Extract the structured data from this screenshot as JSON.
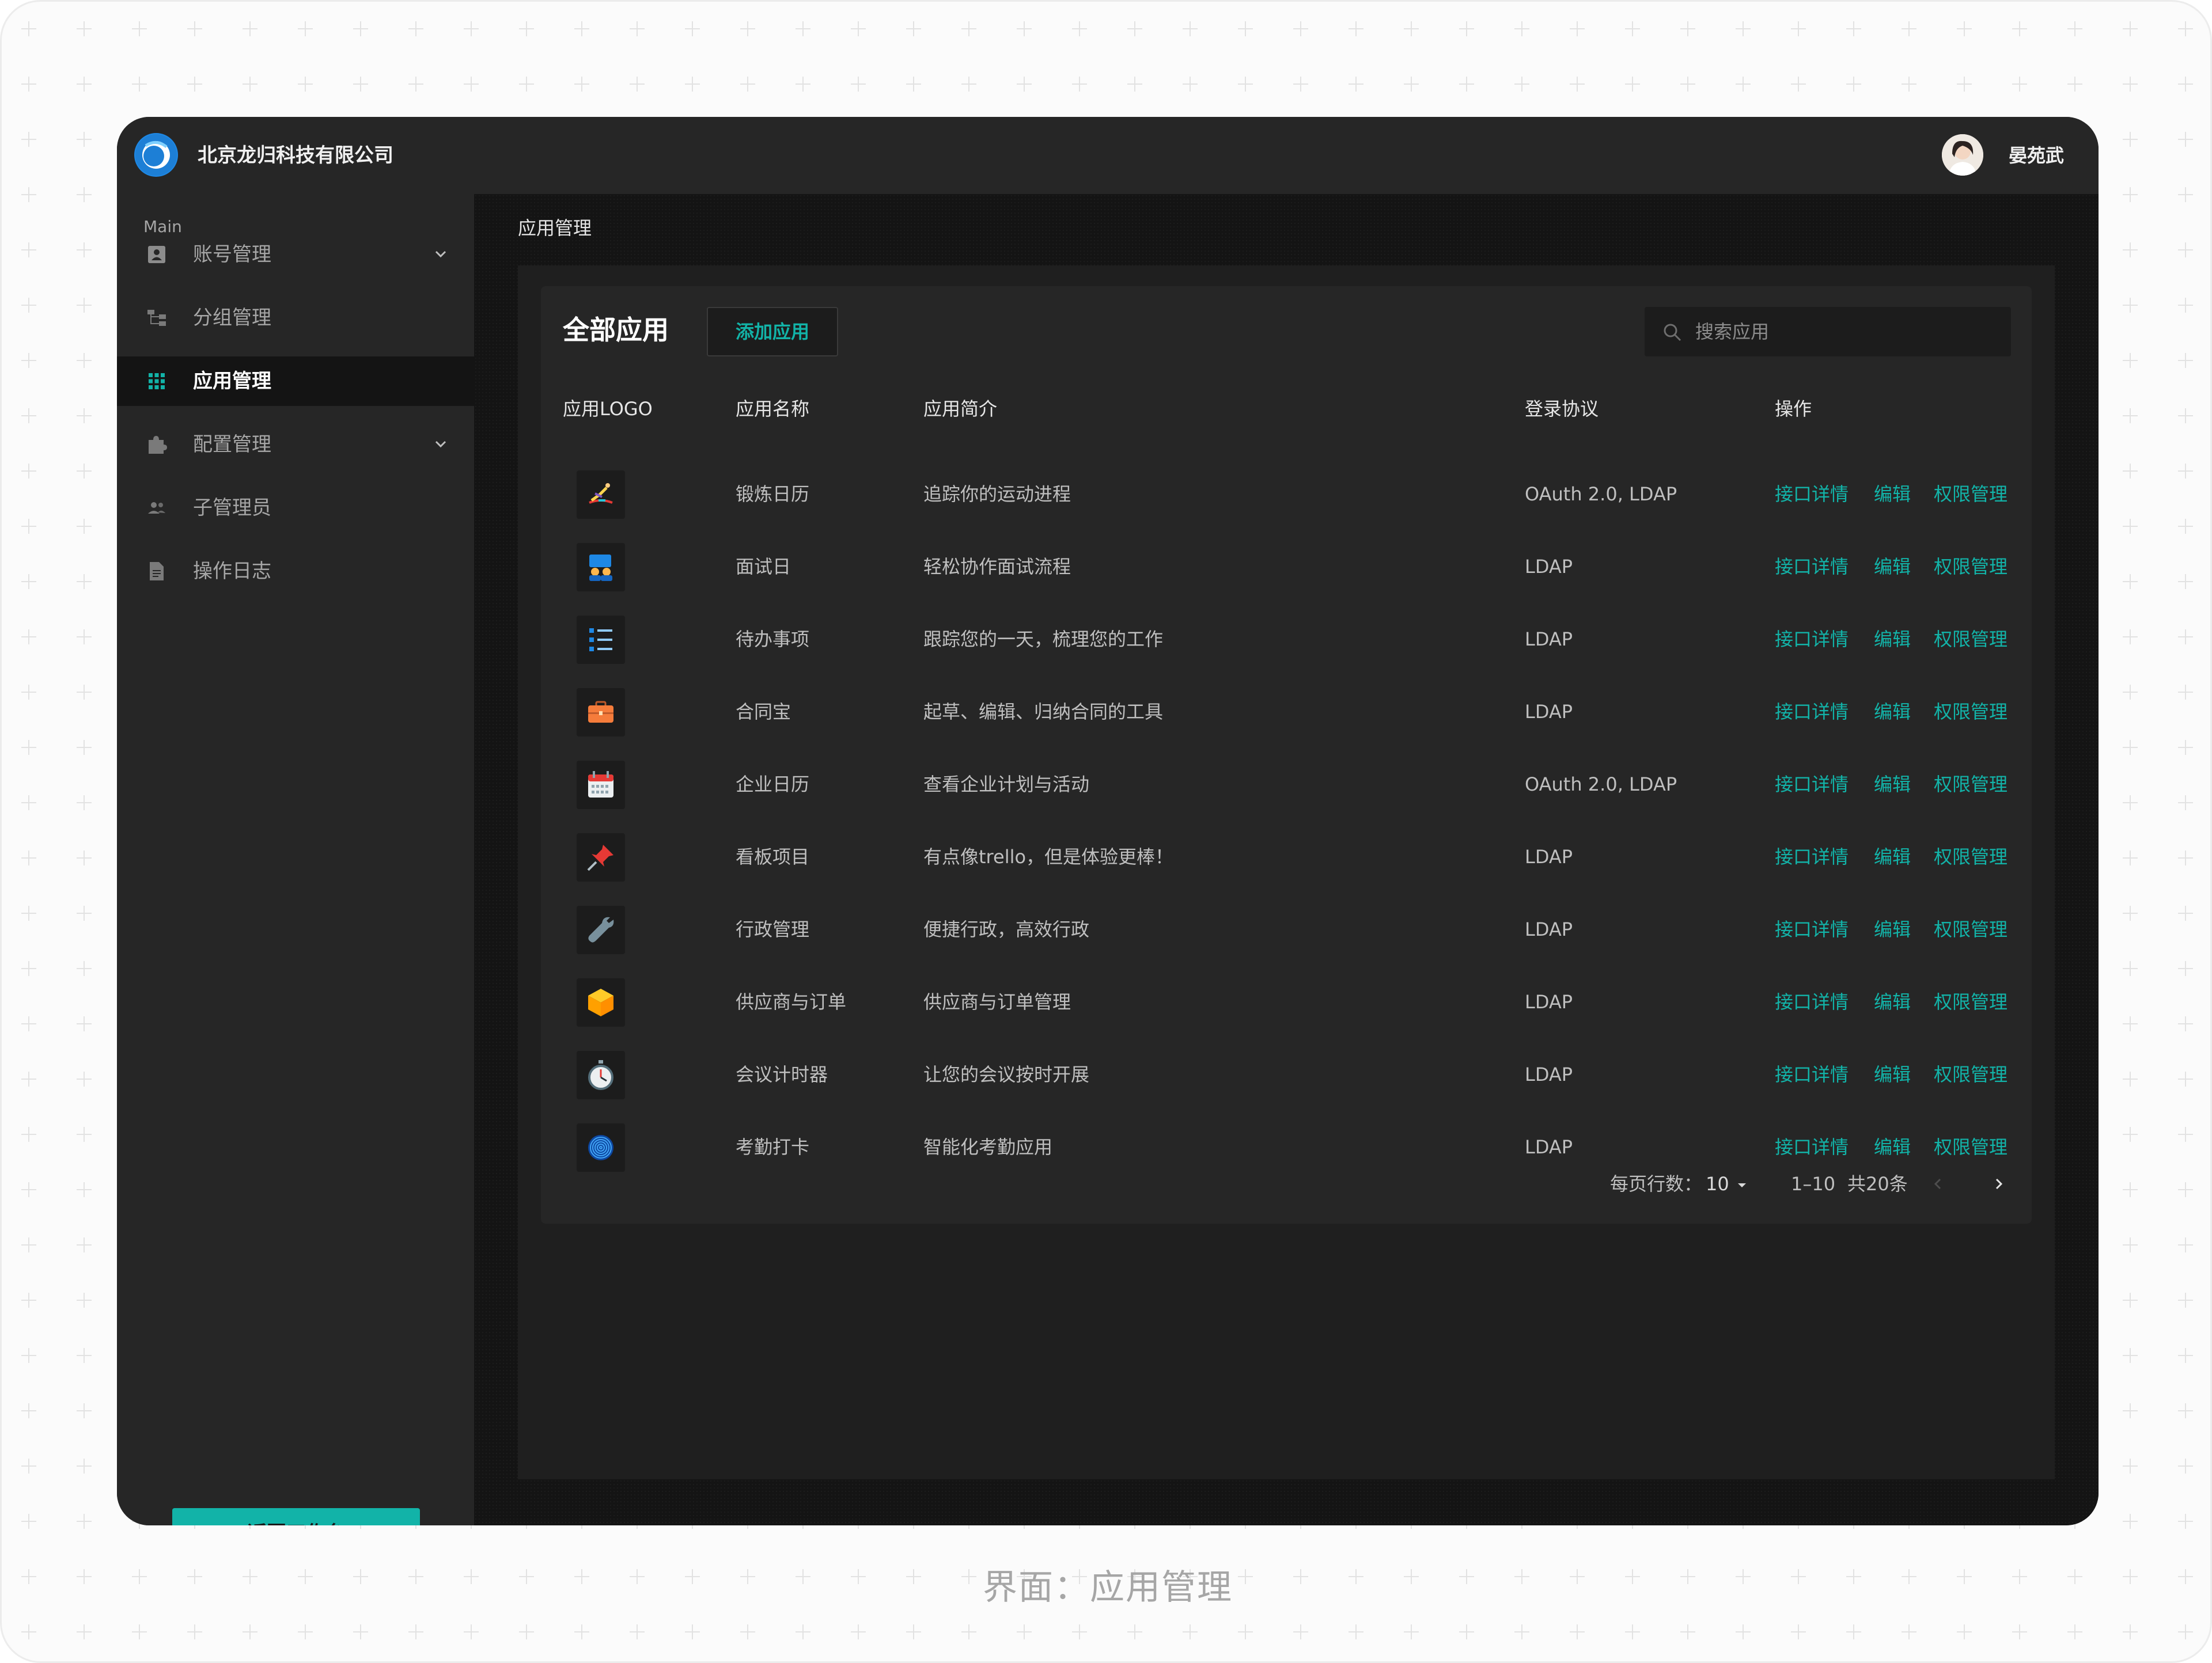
{
  "header": {
    "company": "北京龙归科技有限公司",
    "user": "晏苑武"
  },
  "sidebar": {
    "section": "Main",
    "items": [
      {
        "label": "账号管理",
        "icon": "id-card-icon",
        "expandable": true,
        "active": false
      },
      {
        "label": "分组管理",
        "icon": "hierarchy-icon",
        "expandable": false,
        "active": false
      },
      {
        "label": "应用管理",
        "icon": "grid-icon",
        "expandable": false,
        "active": true
      },
      {
        "label": "配置管理",
        "icon": "puzzle-icon",
        "expandable": true,
        "active": false
      },
      {
        "label": "子管理员",
        "icon": "users-icon",
        "expandable": false,
        "active": false
      },
      {
        "label": "操作日志",
        "icon": "document-icon",
        "expandable": false,
        "active": false
      }
    ],
    "back_label": "返回工作台"
  },
  "breadcrumb": "应用管理",
  "card": {
    "title": "全部应用",
    "add_label": "添加应用",
    "search_placeholder": "搜索应用"
  },
  "table": {
    "columns": [
      "应用LOGO",
      "应用名称",
      "应用简介",
      "登录协议",
      "操作"
    ],
    "actions": [
      "接口详情",
      "编辑",
      "权限管理"
    ],
    "rows": [
      {
        "name": "锻炼日历",
        "desc": "追踪你的运动进程",
        "protocol": "OAuth 2.0, LDAP",
        "logo": "exercise-icon"
      },
      {
        "name": "面试日",
        "desc": "轻松协作面试流程",
        "protocol": "LDAP",
        "logo": "interview-icon"
      },
      {
        "name": "待办事项",
        "desc": "跟踪您的一天，梳理您的工作",
        "protocol": "LDAP",
        "logo": "checklist-icon"
      },
      {
        "name": "合同宝",
        "desc": "起草、编辑、归纳合同的工具",
        "protocol": "LDAP",
        "logo": "briefcase-icon"
      },
      {
        "name": "企业日历",
        "desc": "查看企业计划与活动",
        "protocol": "OAuth 2.0, LDAP",
        "logo": "calendar-icon"
      },
      {
        "name": "看板项目",
        "desc": "有点像trello，但是体验更棒！",
        "protocol": "LDAP",
        "logo": "pushpin-icon"
      },
      {
        "name": "行政管理",
        "desc": "便捷行政，高效行政",
        "protocol": "LDAP",
        "logo": "wrench-icon"
      },
      {
        "name": "供应商与订单",
        "desc": "供应商与订单管理",
        "protocol": "LDAP",
        "logo": "box-icon"
      },
      {
        "name": "会议计时器",
        "desc": "让您的会议按时开展",
        "protocol": "LDAP",
        "logo": "stopwatch-icon"
      },
      {
        "name": "考勤打卡",
        "desc": "智能化考勤应用",
        "protocol": "LDAP",
        "logo": "fingerprint-icon"
      }
    ]
  },
  "pagination": {
    "rows_per_page_label": "每页行数：",
    "rows_per_page_value": "10",
    "range": "1–10",
    "total": "共20条"
  },
  "caption": "界面：应用管理",
  "colors": {
    "accent": "#12b3a8",
    "topbar": "#262626",
    "sidebar": "#262626",
    "main_bg": "#141414"
  }
}
